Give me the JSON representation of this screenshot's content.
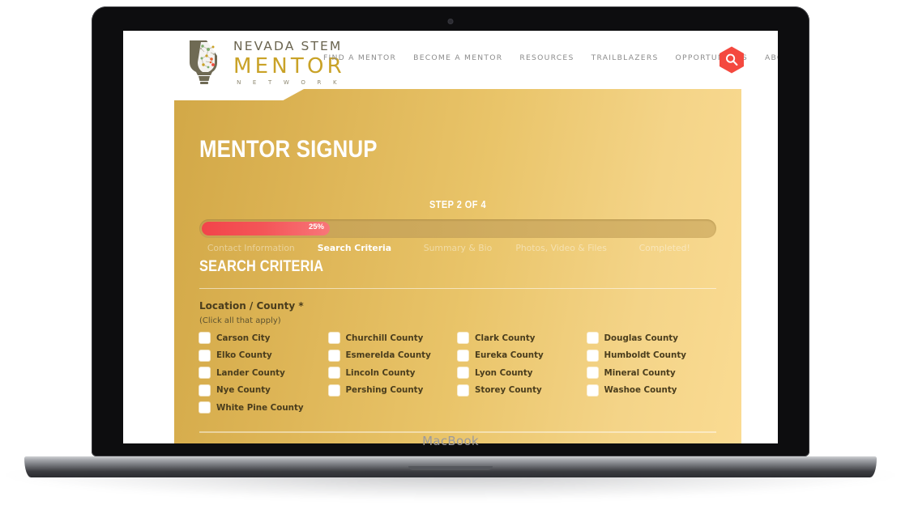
{
  "device": {
    "brand_label": "MacBook"
  },
  "header": {
    "logo": {
      "line1": "NEVADA STEM",
      "line2": "MENTOR",
      "line3": "N E T W O R K"
    },
    "nav": [
      {
        "label": "FIND A MENTOR"
      },
      {
        "label": "BECOME A MENTOR"
      },
      {
        "label": "RESOURCES"
      },
      {
        "label": "TRAILBLAZERS"
      },
      {
        "label": "OPPORTUNITIES"
      },
      {
        "label": "ABOUT US"
      }
    ],
    "search_icon": "search-icon"
  },
  "page": {
    "title": "MENTOR SIGNUP",
    "step_indicator": "STEP 2 OF 4",
    "progress": {
      "percent_label": "25%",
      "percent_value": 25,
      "fill_color": "#f2444a",
      "track_color": "#cda95c"
    },
    "steps": [
      {
        "label": "Contact Information",
        "active": false
      },
      {
        "label": "Search Criteria",
        "active": true
      },
      {
        "label": "Summary & Bio",
        "active": false
      },
      {
        "label": "Photos, Video & Files",
        "active": false
      },
      {
        "label": "Completed!",
        "active": false
      }
    ],
    "section_title": "SEARCH CRITERIA",
    "field": {
      "label": "Location / County *",
      "hint": "(Click all that apply)"
    },
    "counties": [
      "Carson City",
      "Churchill County",
      "Clark County",
      "Douglas County",
      "Elko County",
      "Esmerelda County",
      "Eureka County",
      "Humboldt County",
      "Lander County",
      "Lincoln County",
      "Lyon County",
      "Mineral County",
      "Nye County",
      "Pershing County",
      "Storey County",
      "Washoe County",
      "White Pine County"
    ]
  },
  "colors": {
    "gold_dark": "#d2a847",
    "gold_light": "#fadb92",
    "accent_red": "#f2444a",
    "logo_gold": "#c9a227",
    "text_brown": "#4a3d1d"
  }
}
